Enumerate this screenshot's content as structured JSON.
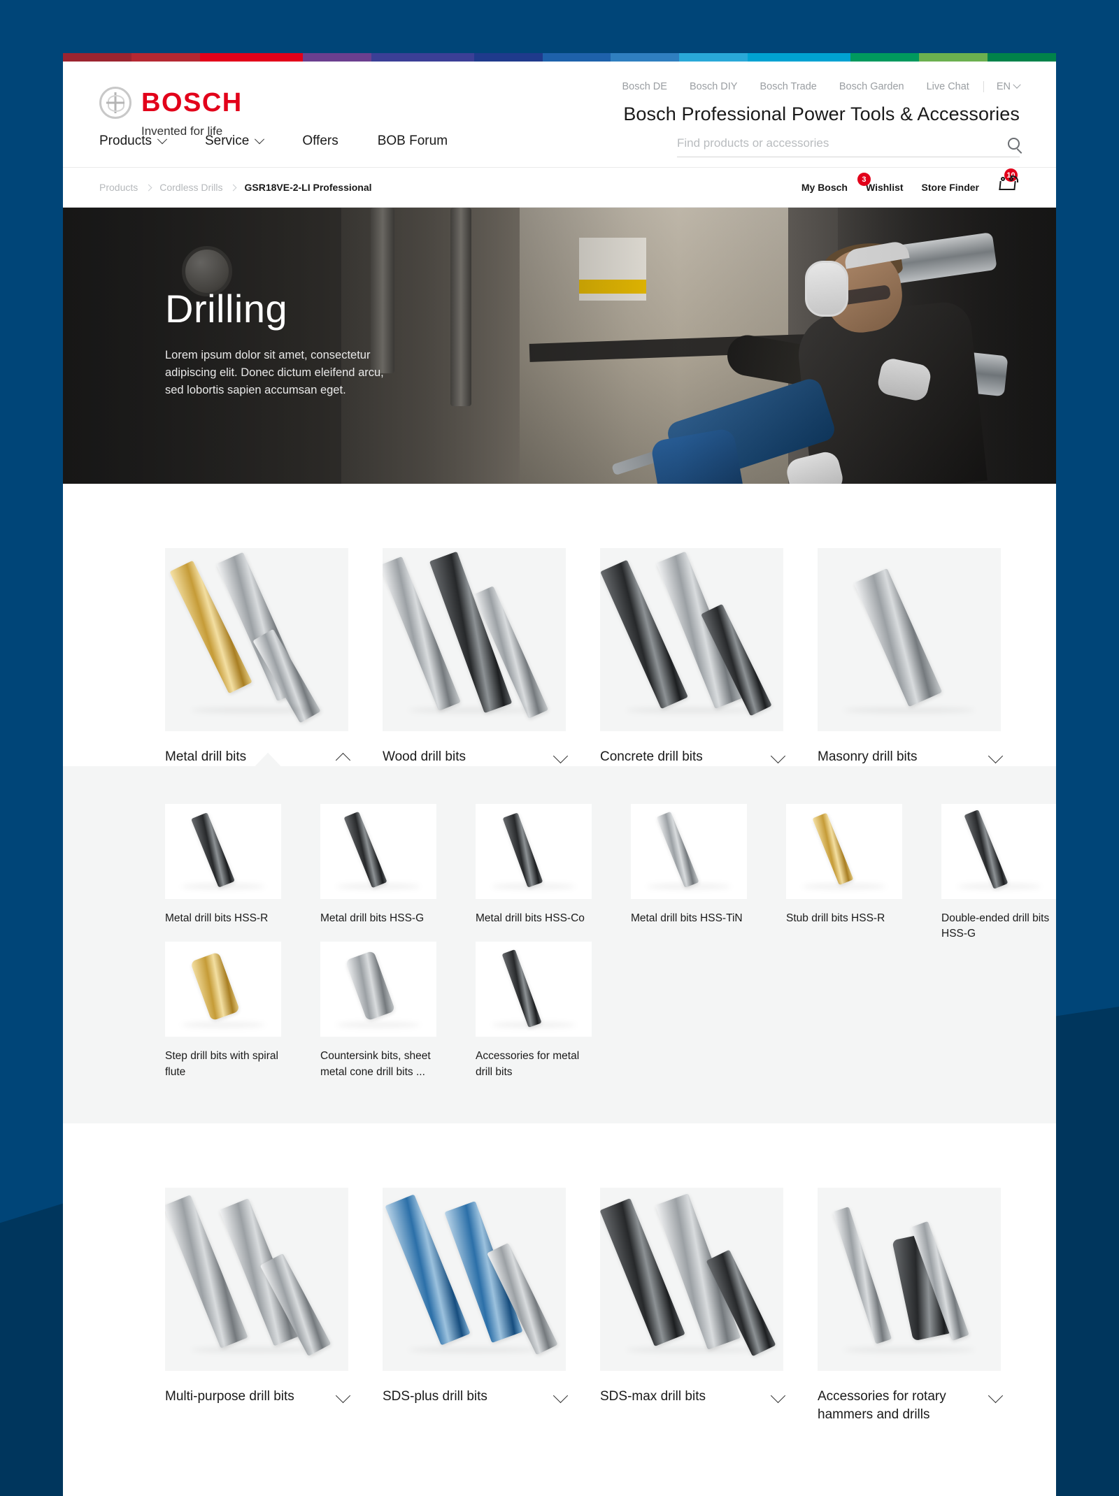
{
  "brand": {
    "name": "BOSCH",
    "tagline": "Invented for life",
    "accent": "#e2001a",
    "logo_icon": "bosch-anchor-logo"
  },
  "supergraphic_colors": [
    "#9c2430",
    "#b52832",
    "#e2001a",
    "#6b3f8f",
    "#3b3f96",
    "#1f3a8c",
    "#1e61ab",
    "#2f7fc0",
    "#29a8d8",
    "#00a2d2",
    "#00995e",
    "#6cb04f",
    "#00824a"
  ],
  "utility_nav": {
    "links": [
      "Bosch DE",
      "Bosch DIY",
      "Bosch Trade",
      "Bosch Garden",
      "Live Chat"
    ],
    "language": "EN",
    "language_icon": "chevron-down-icon"
  },
  "site_title": "Bosch Professional Power Tools & Accessories",
  "search": {
    "placeholder": "Find products or accessories",
    "value": "",
    "icon": "search-icon"
  },
  "main_nav": [
    {
      "label": "Products",
      "has_dropdown": true
    },
    {
      "label": "Service",
      "has_dropdown": true
    },
    {
      "label": "Offers",
      "has_dropdown": false
    },
    {
      "label": "BOB Forum",
      "has_dropdown": false
    }
  ],
  "breadcrumb": {
    "items": [
      "Products",
      "Cordless Drills"
    ],
    "current": "GSR18VE-2-LI Professional",
    "separator_icon": "chevron-right-icon"
  },
  "crumb_tools": {
    "my_bosch": "My Bosch",
    "wishlist": "Wishlist",
    "wishlist_badge": "3",
    "store_finder": "Store Finder",
    "cart_icon": "shopping-cart-icon",
    "cart_badge": "10"
  },
  "hero": {
    "title": "Drilling",
    "subtitle": "Lorem ipsum dolor sit amet, consectetur adipiscing elit. Donec dictum eleifend arcu, sed lobortis sapien accumsan eget.",
    "image_alt": "worker-with-rotary-hammer"
  },
  "categories_top": [
    {
      "label": "Metal drill bits",
      "expanded": true,
      "toggle_icon": "chevron-up-icon",
      "image_alt": "metal-drill-bits"
    },
    {
      "label": "Wood drill bits",
      "expanded": false,
      "toggle_icon": "chevron-down-icon",
      "image_alt": "wood-drill-bits"
    },
    {
      "label": "Concrete drill bits",
      "expanded": false,
      "toggle_icon": "chevron-down-icon",
      "image_alt": "concrete-drill-bits"
    },
    {
      "label": "Masonry drill bits",
      "expanded": false,
      "toggle_icon": "chevron-down-icon",
      "image_alt": "masonry-drill-bits"
    }
  ],
  "subcategories": [
    {
      "label": "Metal drill bits HSS-R",
      "image_alt": "hss-r-bit"
    },
    {
      "label": "Metal drill bits HSS-G",
      "image_alt": "hss-g-bit"
    },
    {
      "label": "Metal drill bits HSS-Co",
      "image_alt": "hss-co-bit"
    },
    {
      "label": "Metal drill bits HSS-TiN",
      "image_alt": "hss-tin-bit"
    },
    {
      "label": "Stub drill bits HSS-R",
      "image_alt": "stub-bit"
    },
    {
      "label": "Double-ended drill bits HSS-G",
      "image_alt": "double-ended-bit"
    },
    {
      "label": "Step drill bits with spiral flute",
      "image_alt": "step-drill-bit"
    },
    {
      "label": "Countersink bits, sheet metal cone drill bits ...",
      "image_alt": "countersink-bit"
    },
    {
      "label": "Accessories for metal drill bits",
      "image_alt": "accessories-metal-bits"
    }
  ],
  "categories_bottom": [
    {
      "label": "Multi-purpose drill bits",
      "expanded": false,
      "toggle_icon": "chevron-down-icon",
      "image_alt": "multi-purpose-drill-bits"
    },
    {
      "label": "SDS-plus drill bits",
      "expanded": false,
      "toggle_icon": "chevron-down-icon",
      "image_alt": "sds-plus-drill-bits"
    },
    {
      "label": "SDS-max drill bits",
      "expanded": false,
      "toggle_icon": "chevron-down-icon",
      "image_alt": "sds-max-drill-bits"
    },
    {
      "label": "Accessories for rotary hammers and drills",
      "expanded": false,
      "toggle_icon": "chevron-down-icon",
      "image_alt": "accessories-rotary-hammers"
    }
  ],
  "theme": {
    "page_background": "#004578",
    "page_background_dark": "#00365d",
    "panel_background": "#ffffff",
    "tile_background": "#f4f5f5"
  }
}
